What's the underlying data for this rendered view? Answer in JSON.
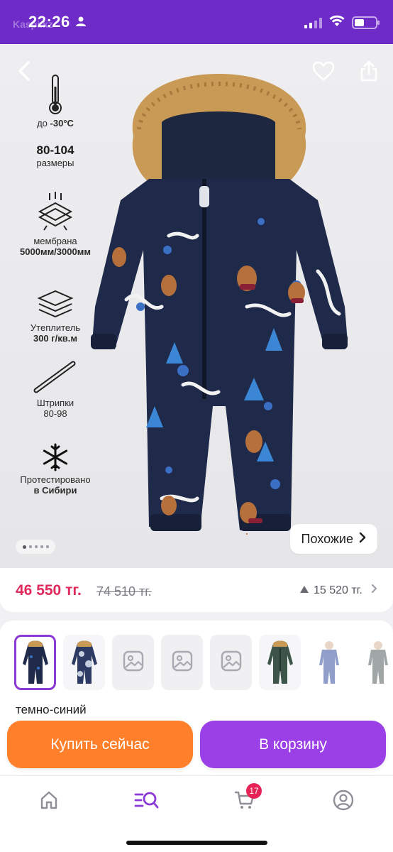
{
  "status_bar": {
    "time": "22:26",
    "app_name": "Kaspi.kz",
    "background_color": "#6f2bc8"
  },
  "hero": {
    "features": [
      {
        "line1": "до",
        "line1_bold": "-30°C",
        "icon": "thermometer-icon"
      },
      {
        "big": "80-104",
        "line2": "размеры",
        "icon": "none"
      },
      {
        "line1": "мембрана",
        "line2": "5000мм/3000мм",
        "icon": "membrane-icon"
      },
      {
        "line1": "Утеплитель",
        "line2": "300 г/кв.м",
        "icon": "layers-icon"
      },
      {
        "line1": "Штрипки",
        "line2": "80-98",
        "icon": "strap-icon"
      },
      {
        "line1": "Протестировано",
        "line2": "в Сибири",
        "icon": "snowflake-icon"
      }
    ],
    "similar_label": "Похожие",
    "gallery_total": 5,
    "gallery_active": 1
  },
  "price": {
    "current": "46 550 тг.",
    "old": "74 510 тг.",
    "points": "15 520 тг.",
    "price_color": "#e0285a"
  },
  "variants": {
    "color_name": "темно-синий",
    "thumbs": [
      {
        "kind": "photo",
        "selected": true,
        "icon": "product-thumb-navy"
      },
      {
        "kind": "photo",
        "selected": false,
        "icon": "product-thumb-camo"
      },
      {
        "kind": "placeholder",
        "selected": false,
        "icon": "image-placeholder-icon"
      },
      {
        "kind": "placeholder",
        "selected": false,
        "icon": "image-placeholder-icon"
      },
      {
        "kind": "placeholder",
        "selected": false,
        "icon": "image-placeholder-icon"
      },
      {
        "kind": "photo",
        "selected": false,
        "icon": "product-thumb-green"
      },
      {
        "kind": "photo",
        "selected": false,
        "icon": "product-thumb-kid-blue"
      },
      {
        "kind": "photo",
        "selected": false,
        "icon": "product-thumb-kid-grey"
      }
    ]
  },
  "actions": {
    "buy_now": "Купить сейчас",
    "add_to_cart": "В корзину",
    "buy_color": "#ff7f2a",
    "cart_color": "#9b3fe6"
  },
  "bottom_nav": {
    "cart_badge": "17",
    "items": [
      "home-icon",
      "catalog-search-icon",
      "cart-icon",
      "profile-icon"
    ],
    "active_color": "#8b3ad6"
  }
}
